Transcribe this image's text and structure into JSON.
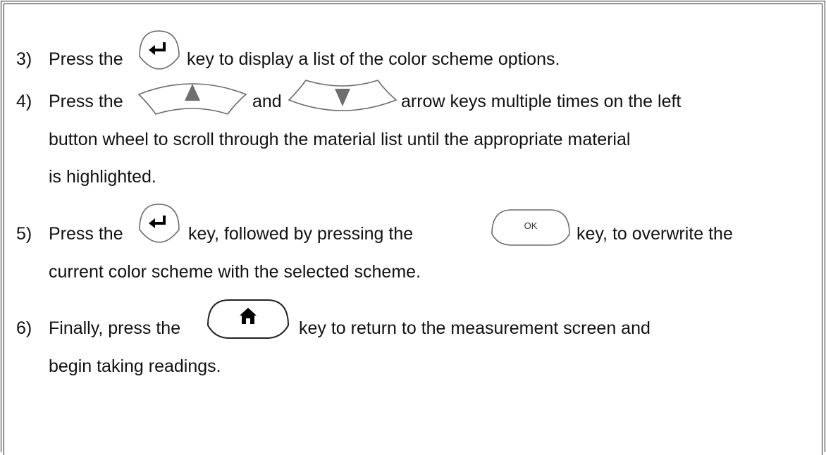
{
  "steps": [
    {
      "number": "3)",
      "segments": [
        "Press the",
        "key to display a list of the color scheme options."
      ],
      "keys": [
        "enter-key"
      ]
    },
    {
      "number": "4)",
      "segments": [
        "Press the",
        "and",
        "arrow keys multiple times on the left"
      ],
      "continuation": [
        "button wheel to scroll through the material list until the appropriate material",
        "is highlighted."
      ],
      "keys": [
        "up-arrow-key",
        "down-arrow-key"
      ]
    },
    {
      "number": "5)",
      "segments": [
        "Press the",
        "key, followed by pressing the",
        "key, to overwrite the"
      ],
      "continuation": [
        "current color scheme with the selected scheme."
      ],
      "keys": [
        "enter-key",
        "ok-key"
      ],
      "ok_label": "OK"
    },
    {
      "number": "6)",
      "segments": [
        "Finally, press the",
        "key to return to the measurement screen and"
      ],
      "continuation": [
        "begin taking readings."
      ],
      "keys": [
        "home-key"
      ]
    }
  ],
  "colors": {
    "key_outline": "#6b6b6b",
    "arrow_fill": "#6e6e6e",
    "text": "#111111"
  },
  "icons": [
    "return-arrow-icon",
    "up-triangle-icon",
    "down-triangle-icon",
    "home-icon"
  ]
}
